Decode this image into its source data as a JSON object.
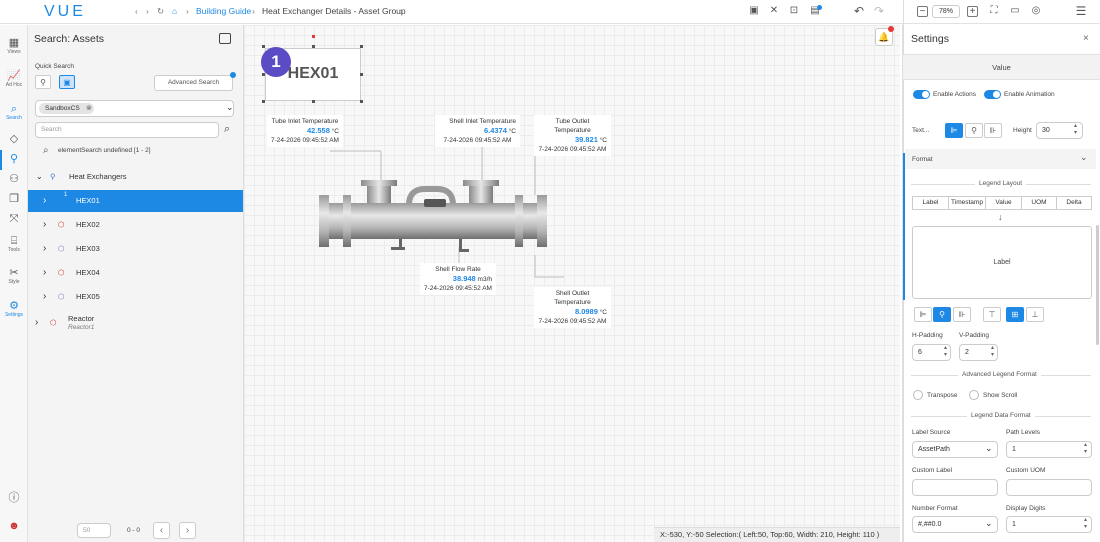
{
  "app": {
    "logo": "VUE"
  },
  "breadcrumb": {
    "home": "Building Guide",
    "current": "Heat Exchanger Details - Asset Group"
  },
  "toolbar": {
    "zoom": "78%"
  },
  "leftnav": [
    {
      "label": "Views"
    },
    {
      "label": "Ad Hoc"
    },
    {
      "label": "Search"
    },
    {
      "label": "Tools"
    },
    {
      "label": "Style"
    },
    {
      "label": "Settings"
    }
  ],
  "search_panel": {
    "title": "Search: Assets",
    "quick_search": "Quick Search",
    "advanced_search": "Advanced Search",
    "chip": "SandboxCS",
    "search_placeholder": "Search",
    "result_text": "elementSearch undefined [1 - 2]",
    "group_label": "Heat Exchangers",
    "items": [
      {
        "label": "HEX01",
        "badge": "1"
      },
      {
        "label": "HEX02"
      },
      {
        "label": "HEX03"
      },
      {
        "label": "HEX04"
      },
      {
        "label": "HEX05"
      }
    ],
    "reactor": {
      "label": "Reactor",
      "sub": "Reactor1"
    },
    "page_size": "50",
    "page_range": "0 - 0"
  },
  "canvas": {
    "title_box": "HEX01",
    "badge": "1",
    "labels": [
      {
        "name": "Tube Inlet Temperature",
        "value": "42.558",
        "uom": "°C",
        "time": "7-24-2026 09:45:52 AM"
      },
      {
        "name": "Shell Inlet Temperature",
        "value": "6.4374",
        "uom": "°C",
        "time": "7-24-2026 09:45:52 AM"
      },
      {
        "name": "Tube Outlet Temperature",
        "value": "39.821",
        "uom": "°C",
        "time": "7-24-2026 09:45:52 AM"
      },
      {
        "name": "Shell Flow Rate",
        "value": "38.948",
        "uom": "m3/h",
        "time": "7-24-2026 09:45:52 AM"
      },
      {
        "name": "Shell Outlet Temperature",
        "value": "8.0989",
        "uom": "°C",
        "time": "7-24-2026 09:45:52 AM"
      }
    ],
    "status": "X:-530, Y:-50  Selection:( Left:50, Top:60, Width: 210, Height: 110 )"
  },
  "settings": {
    "title": "Settings",
    "section": "Value",
    "enable_actions": "Enable Actions",
    "enable_animation": "Enable Animation",
    "text_label": "Text...",
    "height_label": "Height",
    "height_value": "30",
    "format": "Format",
    "legend_layout": "Legend Layout",
    "legend_tabs": [
      "Label",
      "Timestamp",
      "Value",
      "UOM",
      "Delta"
    ],
    "legend_preview": "Label",
    "h_padding_label": "H-Padding",
    "h_padding_value": "6",
    "v_padding_label": "V-Padding",
    "v_padding_value": "2",
    "advanced_legend_format": "Advanced Legend Format",
    "transpose": "Transpose",
    "show_scroll": "Show Scroll",
    "legend_data_format": "Legend Data Format",
    "label_source_label": "Label Source",
    "label_source_value": "AssetPath",
    "path_levels_label": "Path Levels",
    "path_levels_value": "1",
    "custom_label": "Custom Label",
    "custom_uom": "Custom UOM",
    "number_format_label": "Number Format",
    "number_format_value": "#,##0.0",
    "display_digits_label": "Display Digits",
    "display_digits_value": "1"
  },
  "colors": {
    "accent": "#1e88e5",
    "badge": "#5b4bc4"
  }
}
